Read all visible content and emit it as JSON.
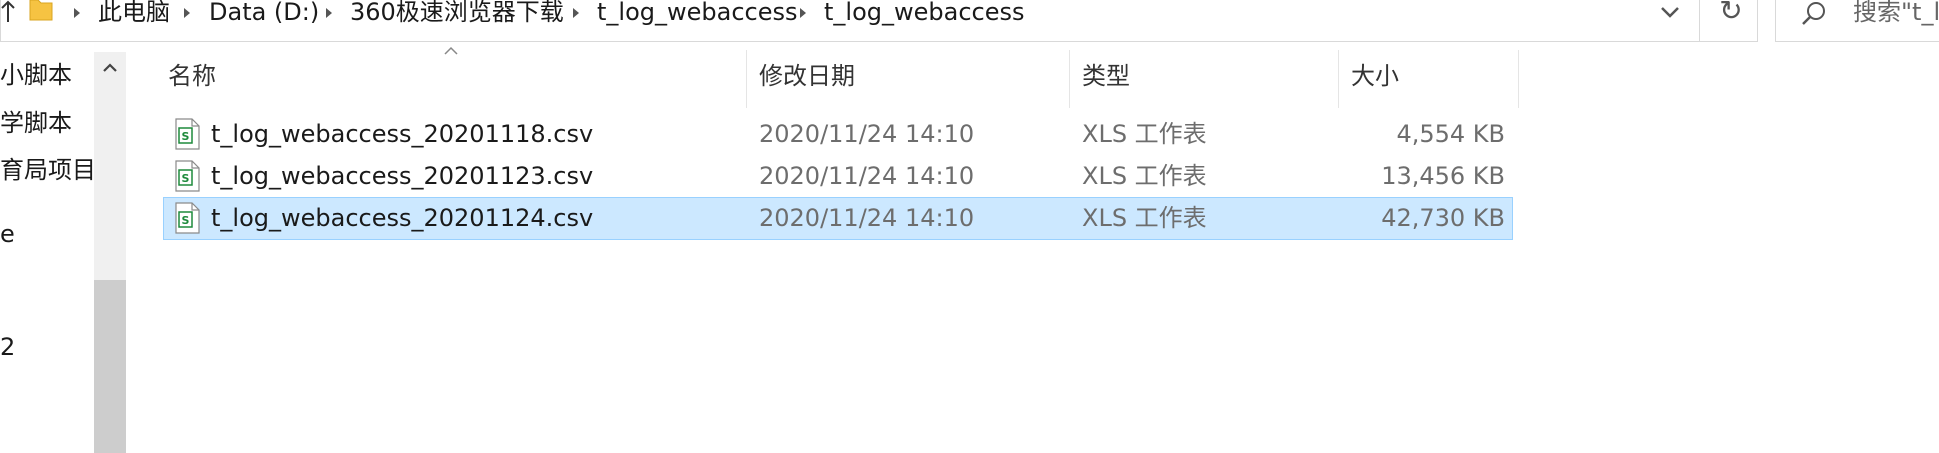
{
  "address_bar": {
    "breadcrumbs": [
      "此电脑",
      "Data (D:)",
      "360极速浏览器下载",
      "t_log_webaccess",
      "t_log_webaccess"
    ]
  },
  "search": {
    "placeholder": "搜索\"t_l"
  },
  "nav_pane": {
    "items": [
      "小脚本",
      "学脚本",
      "育局项目",
      "e",
      "",
      "2"
    ]
  },
  "columns": {
    "name": "名称",
    "date": "修改日期",
    "type": "类型",
    "size": "大小"
  },
  "files": [
    {
      "name": "t_log_webaccess_20201118.csv",
      "date": "2020/11/24 14:10",
      "type": "XLS 工作表",
      "size": "4,554 KB",
      "selected": false
    },
    {
      "name": "t_log_webaccess_20201123.csv",
      "date": "2020/11/24 14:10",
      "type": "XLS 工作表",
      "size": "13,456 KB",
      "selected": false
    },
    {
      "name": "t_log_webaccess_20201124.csv",
      "date": "2020/11/24 14:10",
      "type": "XLS 工作表",
      "size": "42,730 KB",
      "selected": true
    }
  ],
  "icons": {
    "up": "up-arrow-icon",
    "folder": "folder-icon",
    "separator": "chevron-right-icon",
    "dropdown": "chevron-down-icon",
    "refresh": "refresh-icon",
    "search": "search-icon",
    "file": "csv-file-icon"
  },
  "colors": {
    "selection_bg": "#cce8ff",
    "selection_border": "#99d1ff",
    "file_icon_green": "#1e8a3c",
    "folder_yellow": "#f6c342"
  }
}
